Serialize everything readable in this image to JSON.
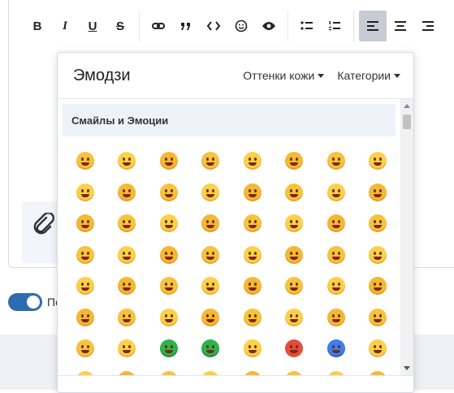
{
  "toolbar": {
    "items": [
      {
        "name": "bold-button",
        "glyph": "B"
      },
      {
        "name": "italic-button",
        "glyph": "I"
      },
      {
        "name": "underline-button",
        "glyph": "U"
      },
      {
        "name": "strikethrough-button",
        "glyph": "S"
      }
    ]
  },
  "popup": {
    "title": "Эмодзи",
    "skin_tones_label": "Оттенки кожи",
    "categories_label": "Категории",
    "category_header": "Смайлы и Эмоции"
  },
  "emoji_rows": [
    [
      "😀",
      "😃",
      "😄",
      "😁",
      "😆",
      "😅",
      "🤣",
      "😂"
    ],
    [
      "🙂",
      "🙃",
      "😉",
      "😊",
      "😇",
      "🥰",
      "😍",
      "🤩"
    ],
    [
      "😘",
      "😗",
      "☺️",
      "😚",
      "😙",
      "🥲",
      "😋",
      "😛"
    ],
    [
      "😜",
      "🤪",
      "😝",
      "🤑",
      "🤗",
      "🤭",
      "🤫",
      "🤔"
    ],
    [
      "🤐",
      "🤨",
      "😐",
      "😑",
      "😶",
      "😏",
      "😒",
      "🙄"
    ],
    [
      "😬",
      "🤥",
      "😌",
      "😔",
      "😪",
      "🤤",
      "😴",
      "😷"
    ],
    [
      "🤒",
      "🤕",
      "🤢",
      "🤮",
      "🤧",
      "🥵",
      "🥶",
      "🥴"
    ],
    [
      "😵",
      "🤯",
      "🤠",
      "🥳",
      "🥸",
      "😎",
      "🤓",
      "🧐"
    ]
  ],
  "toggle": {
    "label_partial": "По"
  },
  "colors": {
    "accent": "#2b6cb0",
    "active_toolbar": "#c7ccd4",
    "category_bg": "#eef3f8"
  }
}
